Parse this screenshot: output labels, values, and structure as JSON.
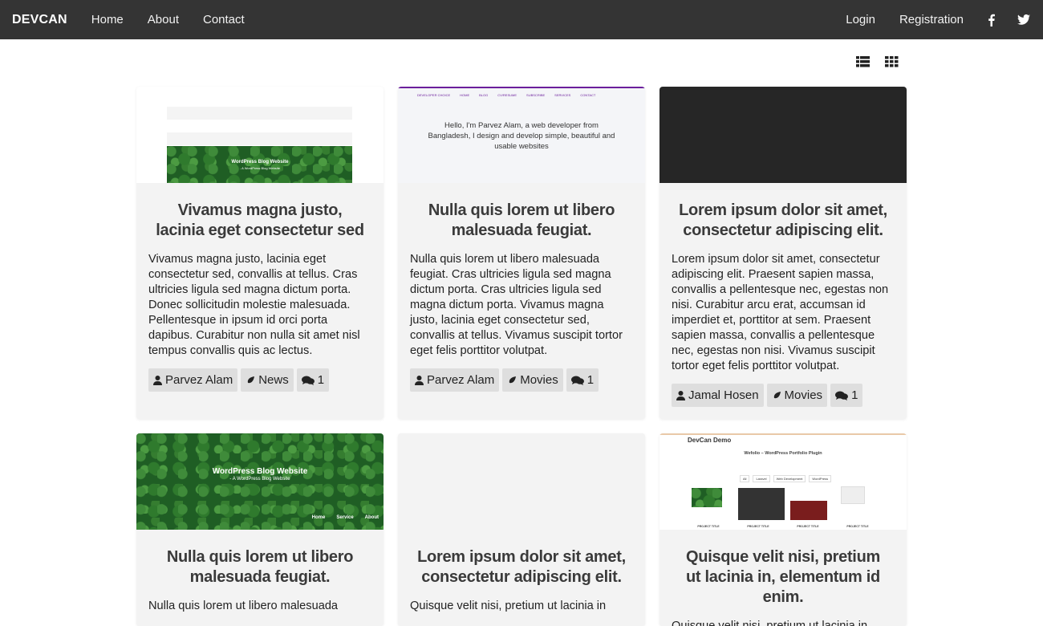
{
  "nav": {
    "brand": "DEVCAN",
    "links": [
      "Home",
      "About",
      "Contact"
    ],
    "right_links": [
      "Login",
      "Registration"
    ],
    "social_icons": [
      "facebook-icon",
      "twitter-icon"
    ],
    "bg_color": "#343434"
  },
  "view_toggles": [
    "list-view-icon",
    "grid-view-icon"
  ],
  "thumbs": {
    "t1": {
      "title": "WordPress Blog Website",
      "subtitle": "- A WordPress Blog Website"
    },
    "t2": {
      "nav": [
        "DEVELOPER CHOICE",
        "HOME",
        "BLOG",
        "CV/RESUME",
        "SUBSCRIBE",
        "SERVICES",
        "CONTACT"
      ],
      "text": "Hello, I'm Parvez Alam, a web developer from Bangladesh, I design and develop simple, beautiful and usable websites"
    },
    "t4": {
      "title": "WordPress Blog Website",
      "subtitle": "- A WordPress Blog Website",
      "links": [
        "Home",
        "Service",
        "About"
      ]
    },
    "t6": {
      "brand": "DevCan Demo",
      "heading": "Wefolio – WordPress Portfolio Plugin",
      "filters": [
        "All",
        "Laravel",
        "Web Development",
        "WordPress"
      ],
      "item_label": "PROJECT TITLE"
    }
  },
  "cards": [
    {
      "title": "Vivamus magna justo, lacinia eget consectetur sed",
      "text": "Vivamus magna justo, lacinia eget consectetur sed, convallis at tellus. Cras ultricies ligula sed magna dictum porta. Donec sollicitudin molestie malesuada. Pellentesque in ipsum id orci porta dapibus. Curabitur non nulla sit amet nisl tempus convallis quis ac lectus.",
      "author": "Parvez Alam",
      "category": "News",
      "comments": "1"
    },
    {
      "title": "Nulla quis lorem ut libero malesuada feugiat.",
      "text": "Nulla quis lorem ut libero malesuada feugiat. Cras ultricies ligula sed magna dictum porta. Cras ultricies ligula sed magna dictum porta. Vivamus magna justo, lacinia eget consectetur sed, convallis at tellus. Vivamus suscipit tortor eget felis porttitor volutpat.",
      "author": "Parvez Alam",
      "category": "Movies",
      "comments": "1"
    },
    {
      "title": "Lorem ipsum dolor sit amet, consectetur adipiscing elit.",
      "text": "Lorem ipsum dolor sit amet, consectetur adipiscing elit. Praesent sapien massa, convallis a pellentesque nec, egestas non nisi. Curabitur arcu erat, accumsan id imperdiet et, porttitor at sem. Praesent sapien massa, convallis a pellentesque nec, egestas non nisi. Vivamus suscipit tortor eget felis porttitor volutpat.",
      "author": "Jamal Hosen",
      "category": "Movies",
      "comments": "1"
    },
    {
      "title": "Nulla quis lorem ut libero malesuada feugiat.",
      "text": "Nulla quis lorem ut libero malesuada"
    },
    {
      "title": "Lorem ipsum dolor sit amet, consectetur adipiscing elit.",
      "text": "Quisque velit nisi, pretium ut lacinia in"
    },
    {
      "title": "Quisque velit nisi, pretium ut lacinia in, elementum id enim.",
      "text": "Quisque velit nisi, pretium ut lacinia in"
    }
  ]
}
